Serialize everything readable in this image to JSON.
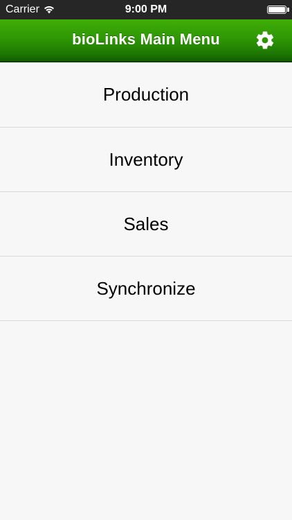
{
  "status_bar": {
    "carrier": "Carrier",
    "time": "9:00 PM",
    "wifi_icon": "wifi-icon",
    "battery_icon": "battery-icon"
  },
  "nav": {
    "title": "bioLinks Main Menu",
    "settings_icon": "gear-icon",
    "bar_color": "#2f9804"
  },
  "menu": {
    "items": [
      {
        "label": "Production"
      },
      {
        "label": "Inventory"
      },
      {
        "label": "Sales"
      },
      {
        "label": "Synchronize"
      }
    ]
  },
  "colors": {
    "background": "#f7f7f7",
    "separator": "#d9d9d9",
    "status_bar": "#262626"
  }
}
